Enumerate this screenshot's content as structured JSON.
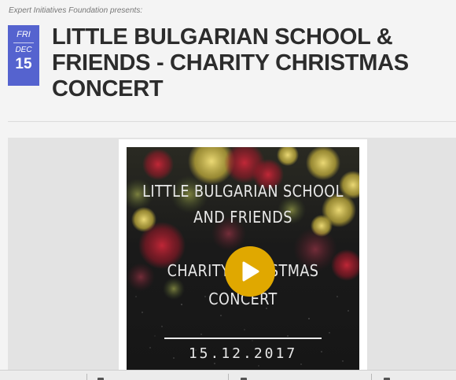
{
  "event": {
    "presenter": "Expert Initiatives Foundation presents:",
    "date": {
      "day_of_week": "FRI",
      "month": "DEC",
      "day": "15"
    },
    "title": "LITTLE BULGARIAN SCHOOL & FRIENDS - CHARITY CHRISTMAS CONCERT"
  },
  "media": {
    "poster_lines": [
      "LITTLE BULGARIAN SCHOOL",
      "AND FRIENDS",
      "CHARITY CHRISTMAS",
      "CONCERT"
    ],
    "poster_date": "15.12.2017",
    "play_icon": "play-icon"
  },
  "colors": {
    "date_badge": "#5563cf",
    "play_button": "#e0a800",
    "title_text": "#2c2c2c"
  }
}
